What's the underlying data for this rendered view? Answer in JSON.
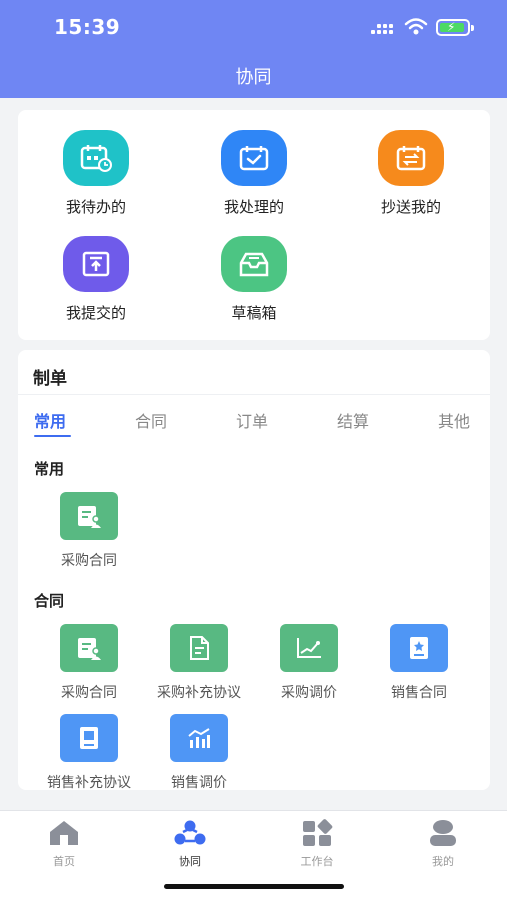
{
  "status_bar": {
    "time": "15:39"
  },
  "header": {
    "title": "协同"
  },
  "quick_actions": [
    {
      "label": "我待办的",
      "icon": "calendar-clock-icon",
      "color": "#1fc2c8"
    },
    {
      "label": "我处理的",
      "icon": "calendar-check-icon",
      "color": "#2f86f6"
    },
    {
      "label": "抄送我的",
      "icon": "forward-icon",
      "color": "#f68a1c"
    },
    {
      "label": "我提交的",
      "icon": "upload-icon",
      "color": "#6f5bea"
    },
    {
      "label": "草稿箱",
      "icon": "inbox-icon",
      "color": "#4cc583"
    }
  ],
  "form_section": {
    "title": "制单",
    "tabs": [
      "常用",
      "合同",
      "订单",
      "结算",
      "其他"
    ],
    "active_tab": "常用",
    "groups": [
      {
        "title": "常用",
        "items": [
          {
            "label": "采购合同",
            "icon": "contract-person-icon",
            "color": "#58b982"
          }
        ]
      },
      {
        "title": "合同",
        "items": [
          {
            "label": "采购合同",
            "icon": "contract-person-icon",
            "color": "#58b982"
          },
          {
            "label": "采购补充协议",
            "icon": "document-icon",
            "color": "#58b982"
          },
          {
            "label": "采购调价",
            "icon": "price-chart-icon",
            "color": "#58b982"
          },
          {
            "label": "销售合同",
            "icon": "sales-contract-icon",
            "color": "#4f96f5"
          },
          {
            "label": "销售补充协议",
            "icon": "book-icon",
            "color": "#4f96f5"
          },
          {
            "label": "销售调价",
            "icon": "bar-chart-icon",
            "color": "#4f96f5"
          }
        ]
      }
    ]
  },
  "tabbar": [
    {
      "label": "首页",
      "icon": "home-icon"
    },
    {
      "label": "协同",
      "icon": "collaboration-icon",
      "active": true
    },
    {
      "label": "工作台",
      "icon": "workbench-icon"
    },
    {
      "label": "我的",
      "icon": "user-icon"
    }
  ]
}
